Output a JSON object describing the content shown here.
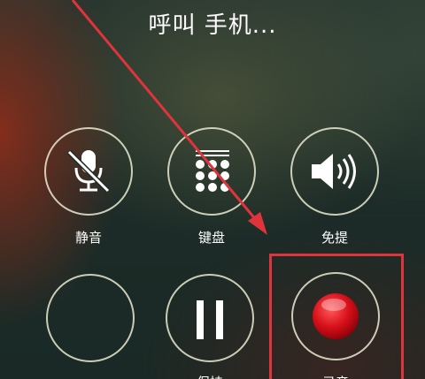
{
  "call": {
    "title": "呼叫 手机..."
  },
  "controls": {
    "mute": {
      "label": "静音",
      "icon": "mic-off-icon"
    },
    "keypad": {
      "label": "键盘",
      "icon": "keypad-icon"
    },
    "speaker": {
      "label": "免提",
      "icon": "speaker-icon"
    },
    "empty": {
      "label": ""
    },
    "hold": {
      "label": "保持",
      "icon": "pause-icon"
    },
    "record": {
      "label": "录音",
      "icon": "record-icon"
    }
  },
  "colors": {
    "highlight": "#e0343c",
    "record": "#d8101a",
    "ring": "#f0f0d7"
  }
}
